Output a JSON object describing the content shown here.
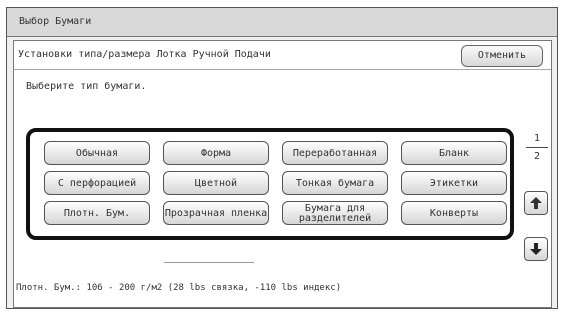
{
  "window": {
    "title": "Выбор Бумаги"
  },
  "header": {
    "subtitle": "Установки типа/размера Лотка Ручной Подачи",
    "cancel_label": "Отменить"
  },
  "instruction": "Выберите тип бумаги.",
  "paper_types": [
    {
      "label": "Обычная"
    },
    {
      "label": "Форма"
    },
    {
      "label": "Переработанная"
    },
    {
      "label": "Бланк"
    },
    {
      "label": "С перфорацией"
    },
    {
      "label": "Цветной"
    },
    {
      "label": "Тонкая бумага"
    },
    {
      "label": "Этикетки"
    },
    {
      "label": "Плотн. Бум."
    },
    {
      "label": "Прозрачная пленка"
    },
    {
      "label": "Бумага для разделителей"
    },
    {
      "label": "Конверты"
    }
  ],
  "pager": {
    "current": "1",
    "total": "2"
  },
  "icons": {
    "up": "arrow-up-icon",
    "down": "arrow-down-icon"
  },
  "info_text": "Плотн. Бум.: 106 - 200 г/м2 (28 lbs связка, -110 lbs индекс)"
}
